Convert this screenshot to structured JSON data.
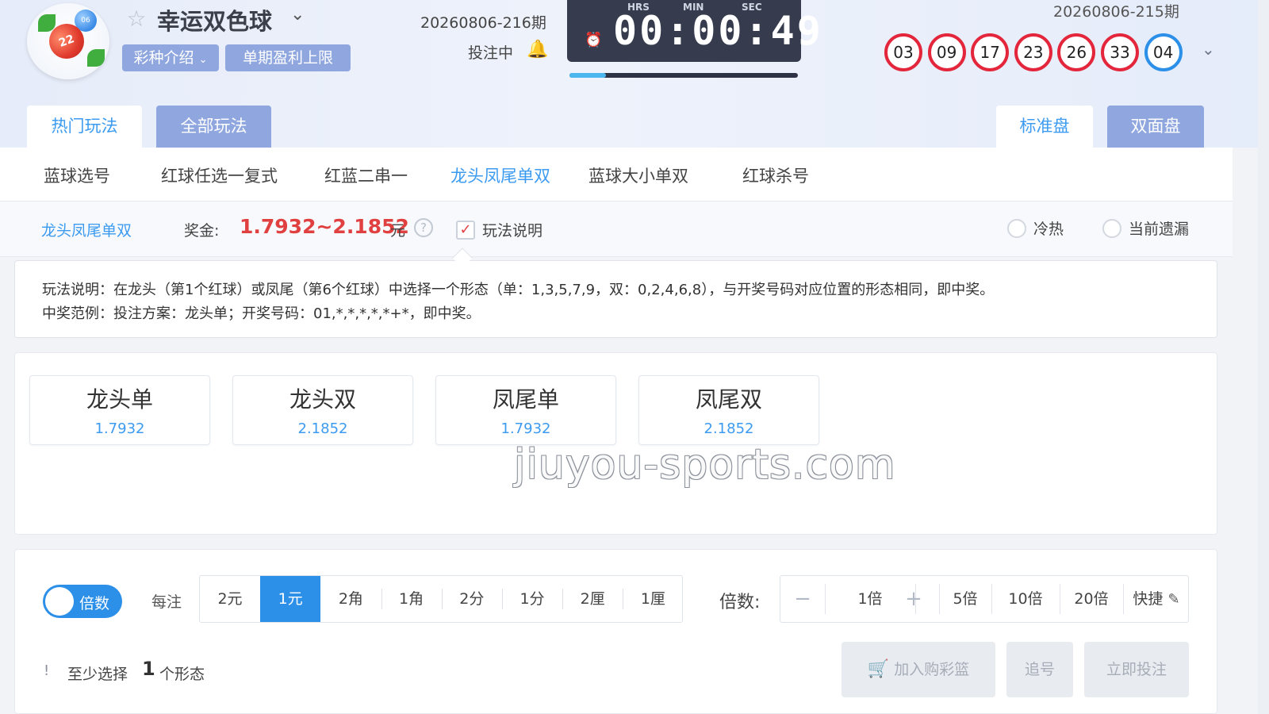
{
  "header": {
    "game_title": "幸运双色球",
    "intro_label": "彩种介绍",
    "profit_limit_label": "单期盈利上限",
    "current_issue": "20260806-216期",
    "betting_status": "投注中",
    "timer": {
      "hrs_label": "HRS",
      "min_label": "MIN",
      "sec_label": "SEC",
      "value": "00:00:49"
    },
    "countdown_progress": 0.16,
    "previous_issue": "20260806-215期",
    "draw_numbers": {
      "red": [
        "03",
        "09",
        "17",
        "23",
        "26",
        "33"
      ],
      "blue": [
        "04"
      ]
    },
    "logo_ball_red": "22",
    "logo_ball_blue": "06"
  },
  "tabs": {
    "hot": "热门玩法",
    "all": "全部玩法",
    "standard": "标准盘",
    "double_face": "双面盘"
  },
  "subnav": [
    "蓝球选号",
    "红球任选一复式",
    "红蓝二串一",
    "龙头凤尾单双",
    "蓝球大小单双",
    "红球杀号"
  ],
  "prize_bar": {
    "active_rule": "龙头凤尾单双",
    "prize_label": "奖金:",
    "prize_value": "1.7932~2.1852",
    "prize_unit": "元",
    "help_icon": "?",
    "rule_toggle_label": "玩法说明",
    "cold_hot_label": "冷热",
    "missing_label": "当前遗漏"
  },
  "rule_text": {
    "line1": "玩法说明：在龙头（第1个红球）或凤尾（第6个红球）中选择一个形态（单：1,3,5,7,9，双：0,2,4,6,8），与开奖号码对应位置的形态相同，即中奖。",
    "line2": "中奖范例：投注方案：龙头单；开奖号码：01,*,*,*,*,*+*，即中奖。"
  },
  "options": [
    {
      "name": "龙头单",
      "odds": "1.7932"
    },
    {
      "name": "龙头双",
      "odds": "2.1852"
    },
    {
      "name": "凤尾单",
      "odds": "1.7932"
    },
    {
      "name": "凤尾双",
      "odds": "2.1852"
    }
  ],
  "watermark": "jiuyou-sports.com",
  "bet": {
    "toggle_label": "倍数",
    "per_bet_label": "每注",
    "units": [
      "2元",
      "1元",
      "2角",
      "1角",
      "2分",
      "1分",
      "2厘",
      "1厘"
    ],
    "selected_unit": "1元",
    "multiplier_label": "倍数:",
    "minus": "−",
    "multiplier_value": "1倍",
    "plus": "+",
    "quick_multipliers": [
      "5倍",
      "10倍",
      "20倍"
    ],
    "quick_label": "快捷",
    "hint_pre": "至少选择",
    "hint_num": "1",
    "hint_post": "个形态",
    "add_cart_label": "加入购彩篮",
    "chase_label": "追号",
    "bet_now_label": "立即投注"
  },
  "colors": {
    "accent": "#2c8fe8",
    "red_ball": "#e3263b",
    "blue_ball": "#2c8fe8",
    "prize_red": "#e04040",
    "timer_bg": "#363c4d"
  },
  "icons": [
    "star-icon",
    "chevron-down-icon",
    "bell-icon",
    "alarm-clock-icon",
    "help-icon",
    "checkmark-icon",
    "edit-icon",
    "cart-icon",
    "info-icon"
  ]
}
